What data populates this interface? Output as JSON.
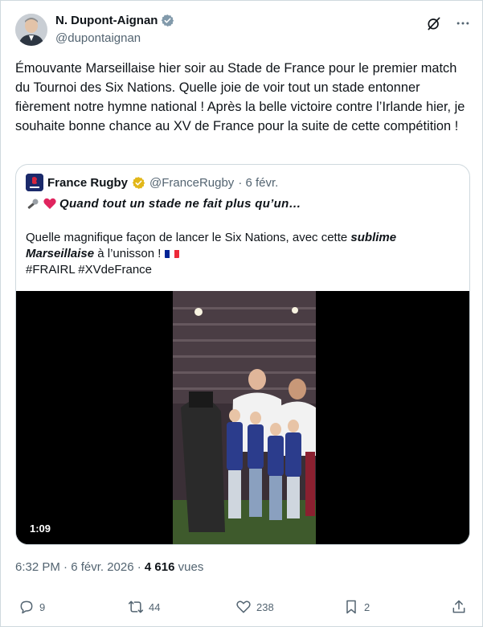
{
  "author": {
    "name": "N. Dupont-Aignan",
    "handle": "@dupontaignan"
  },
  "tweet": {
    "text": "Émouvante Marseillaise hier soir au Stade de France pour le premier match du Tournoi des Six Nations. Quelle joie de voir tout un stade entonner fièrement notre hymne national ! Après la belle victoire contre l’Irlande hier, je souhaite bonne chance au XV de France pour la suite de cette compétition !"
  },
  "quote": {
    "name": "France Rugby",
    "handle": "@FranceRugby",
    "date": "· 6 févr.",
    "line1": "Quand tout un stade ne fait plus qu’un…",
    "text_pre": "Quelle magnifique façon de lancer le Six Nations, avec cette ",
    "text_bold": "sublime Marseillaise",
    "text_post": " à l’unisson !",
    "hashtags": "#FRAIRL #XVdeFrance",
    "video_duration": "1:09"
  },
  "meta": {
    "time": "6:32 PM · 6 févr. 2026 · ",
    "views_count": "4 616",
    "views_label": " vues"
  },
  "actions": {
    "replies": "9",
    "reposts": "44",
    "likes": "238",
    "bookmarks": "2"
  },
  "colors": {
    "verified_blue": "#1d9bf0",
    "verified_gold": "#e2b719",
    "muted": "#536471"
  }
}
